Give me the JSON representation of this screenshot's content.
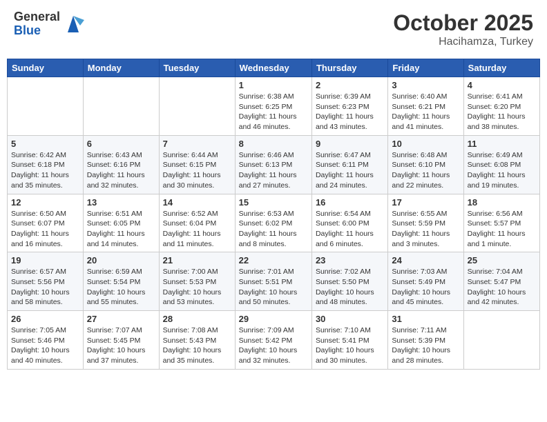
{
  "header": {
    "logo_general": "General",
    "logo_blue": "Blue",
    "month": "October 2025",
    "location": "Hacihamza, Turkey"
  },
  "weekdays": [
    "Sunday",
    "Monday",
    "Tuesday",
    "Wednesday",
    "Thursday",
    "Friday",
    "Saturday"
  ],
  "weeks": [
    [
      {
        "day": "",
        "info": ""
      },
      {
        "day": "",
        "info": ""
      },
      {
        "day": "",
        "info": ""
      },
      {
        "day": "1",
        "info": "Sunrise: 6:38 AM\nSunset: 6:25 PM\nDaylight: 11 hours\nand 46 minutes."
      },
      {
        "day": "2",
        "info": "Sunrise: 6:39 AM\nSunset: 6:23 PM\nDaylight: 11 hours\nand 43 minutes."
      },
      {
        "day": "3",
        "info": "Sunrise: 6:40 AM\nSunset: 6:21 PM\nDaylight: 11 hours\nand 41 minutes."
      },
      {
        "day": "4",
        "info": "Sunrise: 6:41 AM\nSunset: 6:20 PM\nDaylight: 11 hours\nand 38 minutes."
      }
    ],
    [
      {
        "day": "5",
        "info": "Sunrise: 6:42 AM\nSunset: 6:18 PM\nDaylight: 11 hours\nand 35 minutes."
      },
      {
        "day": "6",
        "info": "Sunrise: 6:43 AM\nSunset: 6:16 PM\nDaylight: 11 hours\nand 32 minutes."
      },
      {
        "day": "7",
        "info": "Sunrise: 6:44 AM\nSunset: 6:15 PM\nDaylight: 11 hours\nand 30 minutes."
      },
      {
        "day": "8",
        "info": "Sunrise: 6:46 AM\nSunset: 6:13 PM\nDaylight: 11 hours\nand 27 minutes."
      },
      {
        "day": "9",
        "info": "Sunrise: 6:47 AM\nSunset: 6:11 PM\nDaylight: 11 hours\nand 24 minutes."
      },
      {
        "day": "10",
        "info": "Sunrise: 6:48 AM\nSunset: 6:10 PM\nDaylight: 11 hours\nand 22 minutes."
      },
      {
        "day": "11",
        "info": "Sunrise: 6:49 AM\nSunset: 6:08 PM\nDaylight: 11 hours\nand 19 minutes."
      }
    ],
    [
      {
        "day": "12",
        "info": "Sunrise: 6:50 AM\nSunset: 6:07 PM\nDaylight: 11 hours\nand 16 minutes."
      },
      {
        "day": "13",
        "info": "Sunrise: 6:51 AM\nSunset: 6:05 PM\nDaylight: 11 hours\nand 14 minutes."
      },
      {
        "day": "14",
        "info": "Sunrise: 6:52 AM\nSunset: 6:04 PM\nDaylight: 11 hours\nand 11 minutes."
      },
      {
        "day": "15",
        "info": "Sunrise: 6:53 AM\nSunset: 6:02 PM\nDaylight: 11 hours\nand 8 minutes."
      },
      {
        "day": "16",
        "info": "Sunrise: 6:54 AM\nSunset: 6:00 PM\nDaylight: 11 hours\nand 6 minutes."
      },
      {
        "day": "17",
        "info": "Sunrise: 6:55 AM\nSunset: 5:59 PM\nDaylight: 11 hours\nand 3 minutes."
      },
      {
        "day": "18",
        "info": "Sunrise: 6:56 AM\nSunset: 5:57 PM\nDaylight: 11 hours\nand 1 minute."
      }
    ],
    [
      {
        "day": "19",
        "info": "Sunrise: 6:57 AM\nSunset: 5:56 PM\nDaylight: 10 hours\nand 58 minutes."
      },
      {
        "day": "20",
        "info": "Sunrise: 6:59 AM\nSunset: 5:54 PM\nDaylight: 10 hours\nand 55 minutes."
      },
      {
        "day": "21",
        "info": "Sunrise: 7:00 AM\nSunset: 5:53 PM\nDaylight: 10 hours\nand 53 minutes."
      },
      {
        "day": "22",
        "info": "Sunrise: 7:01 AM\nSunset: 5:51 PM\nDaylight: 10 hours\nand 50 minutes."
      },
      {
        "day": "23",
        "info": "Sunrise: 7:02 AM\nSunset: 5:50 PM\nDaylight: 10 hours\nand 48 minutes."
      },
      {
        "day": "24",
        "info": "Sunrise: 7:03 AM\nSunset: 5:49 PM\nDaylight: 10 hours\nand 45 minutes."
      },
      {
        "day": "25",
        "info": "Sunrise: 7:04 AM\nSunset: 5:47 PM\nDaylight: 10 hours\nand 42 minutes."
      }
    ],
    [
      {
        "day": "26",
        "info": "Sunrise: 7:05 AM\nSunset: 5:46 PM\nDaylight: 10 hours\nand 40 minutes."
      },
      {
        "day": "27",
        "info": "Sunrise: 7:07 AM\nSunset: 5:45 PM\nDaylight: 10 hours\nand 37 minutes."
      },
      {
        "day": "28",
        "info": "Sunrise: 7:08 AM\nSunset: 5:43 PM\nDaylight: 10 hours\nand 35 minutes."
      },
      {
        "day": "29",
        "info": "Sunrise: 7:09 AM\nSunset: 5:42 PM\nDaylight: 10 hours\nand 32 minutes."
      },
      {
        "day": "30",
        "info": "Sunrise: 7:10 AM\nSunset: 5:41 PM\nDaylight: 10 hours\nand 30 minutes."
      },
      {
        "day": "31",
        "info": "Sunrise: 7:11 AM\nSunset: 5:39 PM\nDaylight: 10 hours\nand 28 minutes."
      },
      {
        "day": "",
        "info": ""
      }
    ]
  ]
}
